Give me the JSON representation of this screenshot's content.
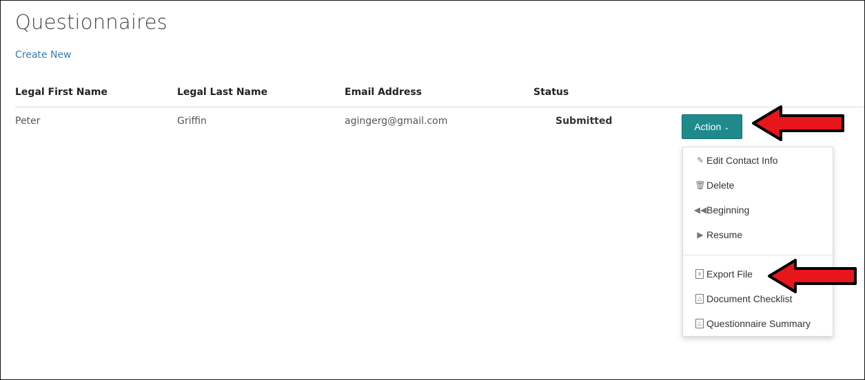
{
  "page": {
    "title": "Questionnaires",
    "create_link": "Create New"
  },
  "table": {
    "headers": [
      "Legal First Name",
      "Legal Last Name",
      "Email Address",
      "Status"
    ],
    "rows": [
      {
        "first": "Peter",
        "last": "Griffin",
        "email": "agingerg@gmail.com",
        "status": "Submitted"
      }
    ]
  },
  "action": {
    "label": "Action",
    "items": [
      {
        "label": "Edit Contact Info",
        "icon": "pencil-icon"
      },
      {
        "label": "Delete",
        "icon": "trash-icon"
      },
      {
        "label": "Beginning",
        "icon": "fast-backward-icon"
      },
      {
        "label": "Resume",
        "icon": "play-icon"
      },
      {
        "label": "Export File",
        "icon": "excel-file-icon"
      },
      {
        "label": "Document Checklist",
        "icon": "pdf-file-icon"
      },
      {
        "label": "Questionnaire Summary",
        "icon": "pdf-file-icon"
      }
    ]
  },
  "colors": {
    "action_button": "#1f8a8c",
    "link": "#3a7bb3",
    "annotation_arrow": "#e8151b"
  }
}
